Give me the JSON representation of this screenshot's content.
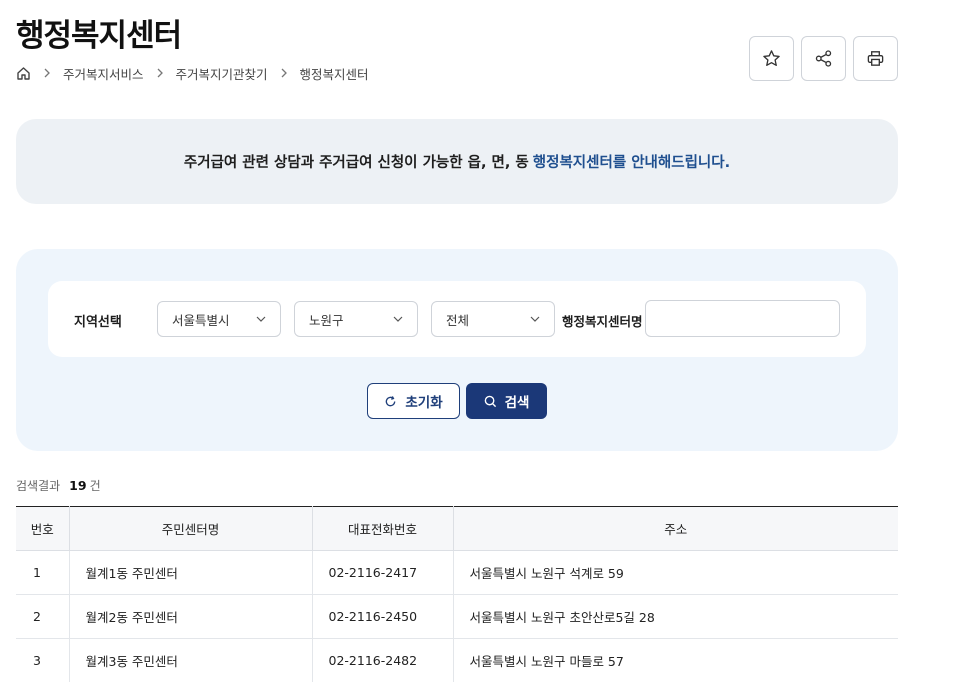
{
  "page": {
    "title": "행정복지센터"
  },
  "breadcrumb": {
    "items": [
      "주거복지서비스",
      "주거복지기관찾기",
      "행정복지센터"
    ]
  },
  "notice": {
    "text": "주거급여 관련 상담과 주거급여 신청이 가능한 읍, 면, 동",
    "highlight": "행정복지센터를 안내해드립니다."
  },
  "search": {
    "region_label": "지역선택",
    "city": "서울특별시",
    "district": "노원구",
    "dong": "전체",
    "center_label": "행정복지센터명",
    "center_value": "",
    "reset_label": "초기화",
    "search_label": "검색"
  },
  "results": {
    "label": "검색결과",
    "count": "19",
    "unit": "건"
  },
  "table": {
    "headers": [
      "번호",
      "주민센터명",
      "대표전화번호",
      "주소"
    ],
    "rows": [
      [
        "1",
        "월계1동 주민센터",
        "02-2116-2417",
        "서울특별시 노원구 석계로 59"
      ],
      [
        "2",
        "월계2동 주민센터",
        "02-2116-2450",
        "서울특별시 노원구 초안산로5길 28"
      ],
      [
        "3",
        "월계3동 주민센터",
        "02-2116-2482",
        "서울특별시 노원구 마들로 57"
      ]
    ]
  },
  "colors": {
    "accent": "#1b3878",
    "notice_bg": "#edf1f5",
    "search_bg": "#eef5fc",
    "highlight": "#1f4f8f"
  },
  "icons": [
    "home-icon",
    "star-icon",
    "share-icon",
    "print-icon",
    "refresh-icon",
    "search-icon",
    "chevron-down-icon",
    "chevron-right-icon"
  ]
}
